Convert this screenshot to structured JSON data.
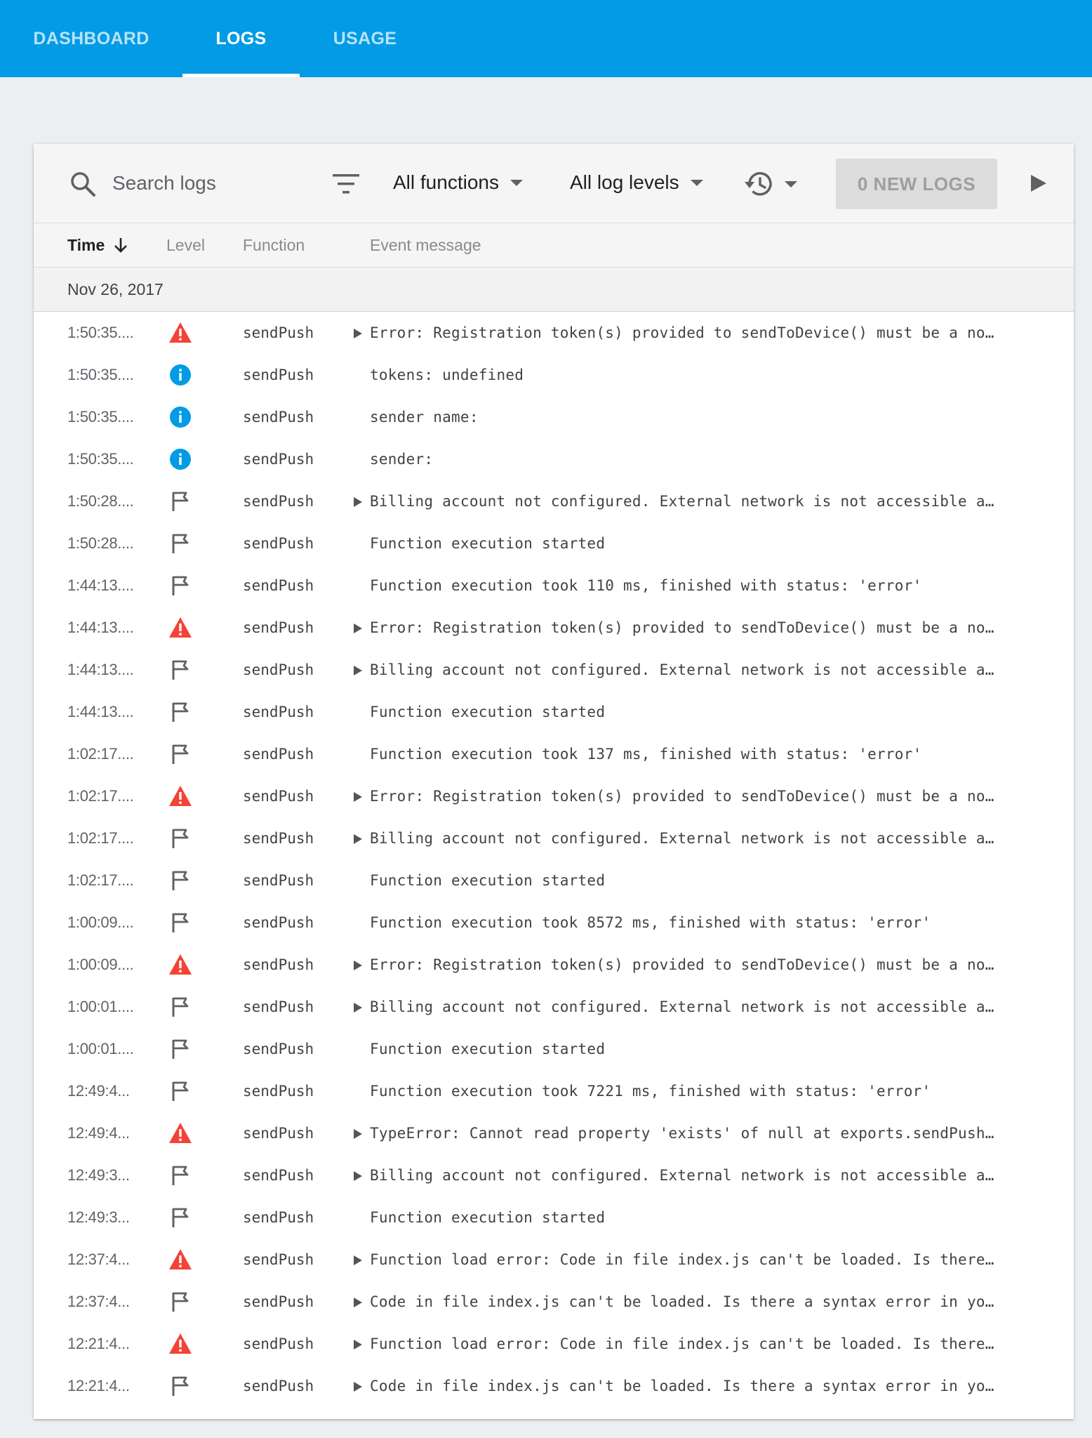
{
  "nav": {
    "tabs": [
      {
        "label": "DASHBOARD"
      },
      {
        "label": "LOGS"
      },
      {
        "label": "USAGE"
      }
    ],
    "active_tab": "LOGS"
  },
  "toolbar": {
    "search_placeholder": "Search logs",
    "functions_dropdown": "All functions",
    "levels_dropdown": "All log levels",
    "new_logs_button": "0 NEW LOGS"
  },
  "table": {
    "headers": {
      "time": "Time",
      "level": "Level",
      "function": "Function",
      "message": "Event message"
    },
    "date_group": "Nov 26, 2017",
    "rows": [
      {
        "time": "1:50:35....",
        "level": "error",
        "function": "sendPush",
        "expandable": true,
        "message": "Error: Registration token(s) provided to sendToDevice() must be a no…"
      },
      {
        "time": "1:50:35....",
        "level": "info",
        "function": "sendPush",
        "expandable": false,
        "message": "tokens: undefined"
      },
      {
        "time": "1:50:35....",
        "level": "info",
        "function": "sendPush",
        "expandable": false,
        "message": "sender name:"
      },
      {
        "time": "1:50:35....",
        "level": "info",
        "function": "sendPush",
        "expandable": false,
        "message": "sender:"
      },
      {
        "time": "1:50:28....",
        "level": "debug",
        "function": "sendPush",
        "expandable": true,
        "message": "Billing account not configured. External network is not accessible a…"
      },
      {
        "time": "1:50:28....",
        "level": "debug",
        "function": "sendPush",
        "expandable": false,
        "message": "Function execution started"
      },
      {
        "time": "1:44:13....",
        "level": "debug",
        "function": "sendPush",
        "expandable": false,
        "message": "Function execution took 110 ms, finished with status: 'error'"
      },
      {
        "time": "1:44:13....",
        "level": "error",
        "function": "sendPush",
        "expandable": true,
        "message": "Error: Registration token(s) provided to sendToDevice() must be a no…"
      },
      {
        "time": "1:44:13....",
        "level": "debug",
        "function": "sendPush",
        "expandable": true,
        "message": "Billing account not configured. External network is not accessible a…"
      },
      {
        "time": "1:44:13....",
        "level": "debug",
        "function": "sendPush",
        "expandable": false,
        "message": "Function execution started"
      },
      {
        "time": "1:02:17....",
        "level": "debug",
        "function": "sendPush",
        "expandable": false,
        "message": "Function execution took 137 ms, finished with status: 'error'"
      },
      {
        "time": "1:02:17....",
        "level": "error",
        "function": "sendPush",
        "expandable": true,
        "message": "Error: Registration token(s) provided to sendToDevice() must be a no…"
      },
      {
        "time": "1:02:17....",
        "level": "debug",
        "function": "sendPush",
        "expandable": true,
        "message": "Billing account not configured. External network is not accessible a…"
      },
      {
        "time": "1:02:17....",
        "level": "debug",
        "function": "sendPush",
        "expandable": false,
        "message": "Function execution started"
      },
      {
        "time": "1:00:09....",
        "level": "debug",
        "function": "sendPush",
        "expandable": false,
        "message": "Function execution took 8572 ms, finished with status: 'error'"
      },
      {
        "time": "1:00:09....",
        "level": "error",
        "function": "sendPush",
        "expandable": true,
        "message": "Error: Registration token(s) provided to sendToDevice() must be a no…"
      },
      {
        "time": "1:00:01....",
        "level": "debug",
        "function": "sendPush",
        "expandable": true,
        "message": "Billing account not configured. External network is not accessible a…"
      },
      {
        "time": "1:00:01....",
        "level": "debug",
        "function": "sendPush",
        "expandable": false,
        "message": "Function execution started"
      },
      {
        "time": "12:49:4...",
        "level": "debug",
        "function": "sendPush",
        "expandable": false,
        "message": "Function execution took 7221 ms, finished with status: 'error'"
      },
      {
        "time": "12:49:4...",
        "level": "error",
        "function": "sendPush",
        "expandable": true,
        "message": "TypeError: Cannot read property 'exists' of null at exports.sendPush…"
      },
      {
        "time": "12:49:3...",
        "level": "debug",
        "function": "sendPush",
        "expandable": true,
        "message": "Billing account not configured. External network is not accessible a…"
      },
      {
        "time": "12:49:3...",
        "level": "debug",
        "function": "sendPush",
        "expandable": false,
        "message": "Function execution started"
      },
      {
        "time": "12:37:4...",
        "level": "error",
        "function": "sendPush",
        "expandable": true,
        "message": "Function load error: Code in file index.js can't be loaded. Is there…"
      },
      {
        "time": "12:37:4...",
        "level": "debug",
        "function": "sendPush",
        "expandable": true,
        "message": "Code in file index.js can't be loaded. Is there a syntax error in yo…"
      },
      {
        "time": "12:21:4...",
        "level": "error",
        "function": "sendPush",
        "expandable": true,
        "message": "Function load error: Code in file index.js can't be loaded. Is there…"
      },
      {
        "time": "12:21:4...",
        "level": "debug",
        "function": "sendPush",
        "expandable": true,
        "message": "Code in file index.js can't be loaded. Is there a syntax error in yo…"
      }
    ]
  },
  "icons": {
    "error": "warning-triangle-icon",
    "info": "info-circle-icon",
    "debug": "flag-icon"
  },
  "colors": {
    "brand": "#039be5",
    "error": "#f44336",
    "info": "#039be5",
    "debug": "#616161"
  }
}
